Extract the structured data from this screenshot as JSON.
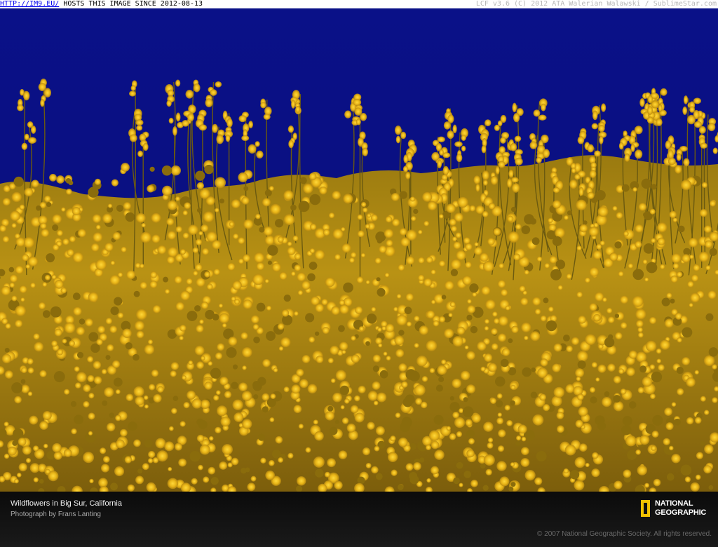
{
  "watermark": {
    "link_text": "HTTP://IM9.EU/",
    "host_text": "HOSTS THIS IMAGE SINCE 2012-08-13",
    "credit_text": "LCF v3.6 (C) 2012 ATA Walerian Walawski / SublimeStar.com"
  },
  "photo": {
    "sky_color": "#0a0f86",
    "flower_color": "#e8b417"
  },
  "caption": {
    "title": "Wildflowers in Big Sur, California",
    "credit": "Photograph by Frans Lanting",
    "copyright": "© 2007 National Geographic Society. All rights reserved.",
    "logo_line1": "NATIONAL",
    "logo_line2": "GEOGRAPHIC"
  }
}
